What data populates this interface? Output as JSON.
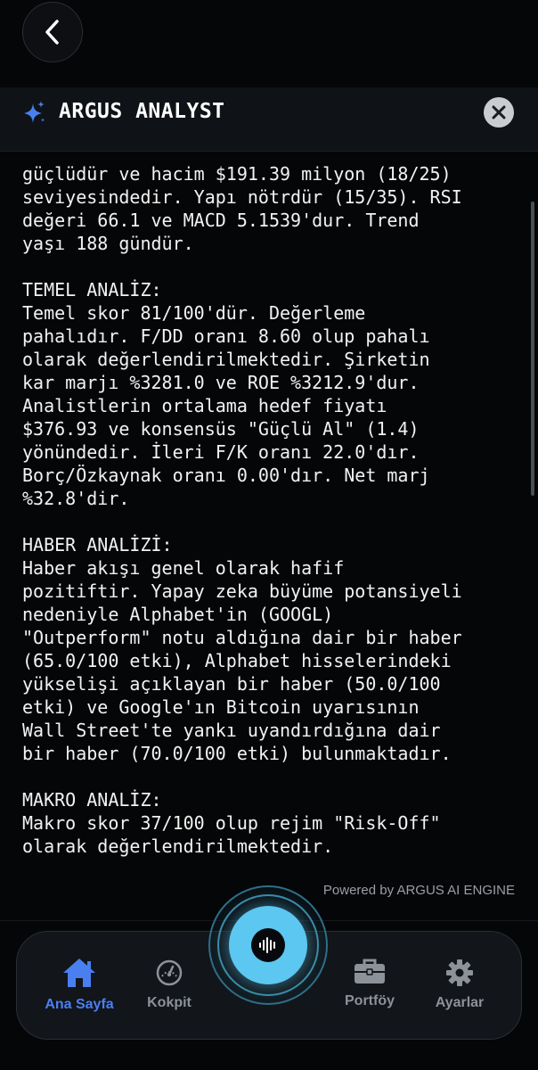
{
  "header": {
    "title": "ARGUS ANALYST"
  },
  "report_lines": [
    "güçlüdür ve hacim $191.39 milyon (18/25)",
    "seviyesindedir. Yapı nötrdür (15/35). RSI",
    "değeri 66.1 ve MACD 5.1539'dur. Trend",
    "yaşı 188 gündür.",
    "",
    "TEMEL ANALİZ:",
    "Temel skor 81/100'dür. Değerleme",
    "pahalıdır. F/DD oranı 8.60 olup pahalı",
    "olarak değerlendirilmektedir. Şirketin",
    "kar marjı %3281.0 ve ROE %3212.9'dur.",
    "Analistlerin ortalama hedef fiyatı",
    "$376.93 ve konsensüs \"Güçlü Al\" (1.4)",
    "yönündedir. İleri F/K oranı 22.0'dır.",
    "Borç/Özkaynak oranı 0.00'dır. Net marj",
    "%32.8'dir.",
    "",
    "HABER ANALİZİ:",
    "Haber akışı genel olarak hafif",
    "pozitiftir. Yapay zeka büyüme potansiyeli",
    "nedeniyle Alphabet'in (GOOGL)",
    "\"Outperform\" notu aldığına dair bir haber",
    "(65.0/100 etki), Alphabet hisselerindeki",
    "yükselişi açıklayan bir haber (50.0/100",
    "etki) ve Google'ın Bitcoin uyarısının",
    "Wall Street'te yankı uyandırdığına dair",
    "bir haber (70.0/100 etki) bulunmaktadır.",
    "",
    "MAKRO ANALİZ:",
    "Makro skor 37/100 olup rejim \"Risk-Off\"",
    "olarak değerlendirilmektedir."
  ],
  "footer": {
    "powered_by": "Powered by ARGUS AI ENGINE"
  },
  "nav": {
    "home": "Ana Sayfa",
    "kokpit": "Kokpit",
    "portfoy": "Portföy",
    "ayarlar": "Ayarlar"
  },
  "colors": {
    "accent_blue": "#4a7ff0",
    "voice_cyan": "#5cc7f0",
    "background": "#050608"
  },
  "icons": {
    "back": "chevron-left-icon",
    "sparkle": "sparkle-icon",
    "close": "close-icon",
    "voice": "waveform-icon",
    "home": "home-icon",
    "kokpit": "gauge-icon",
    "portfoy": "briefcase-icon",
    "ayarlar": "gear-icon"
  }
}
